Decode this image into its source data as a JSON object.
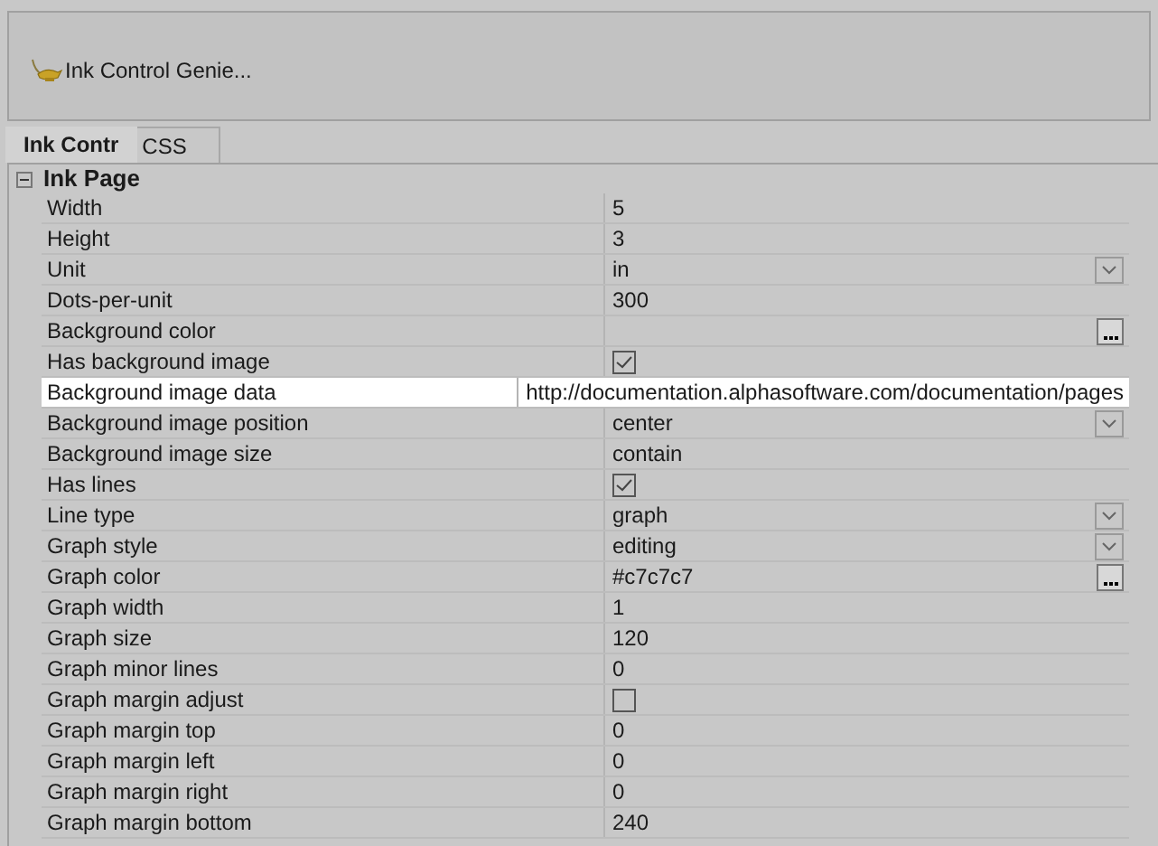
{
  "toolbar": {
    "button": "Ink Control Genie..."
  },
  "tabs": [
    {
      "label": "Ink Contr",
      "selected": true
    },
    {
      "label": "CSS",
      "selected": false
    }
  ],
  "grid": {
    "group": {
      "label": "Ink Page",
      "expanded": true
    },
    "rows": [
      {
        "label": "Width",
        "value": "5",
        "kind": "text",
        "selected": false
      },
      {
        "label": "Height",
        "value": "3",
        "kind": "text",
        "selected": false
      },
      {
        "label": "Unit",
        "value": "in",
        "kind": "dropdown",
        "selected": false
      },
      {
        "label": "Dots-per-unit",
        "value": "300",
        "kind": "text",
        "selected": false
      },
      {
        "label": "Background color",
        "kind": "ellipsis",
        "selected": false
      },
      {
        "label": "Has background image",
        "kind": "checkbox",
        "checked": true,
        "selected": false
      },
      {
        "label": "Background image data",
        "value": "http://documentation.alphasoftware.com/documentation/pages",
        "kind": "text",
        "selected": true
      },
      {
        "label": "Background image position",
        "value": "center",
        "kind": "dropdown",
        "selected": false
      },
      {
        "label": "Background image size",
        "value": "contain",
        "kind": "text",
        "selected": false
      },
      {
        "label": "Has lines",
        "kind": "checkbox",
        "checked": true,
        "selected": false
      },
      {
        "label": "Line type",
        "value": "graph",
        "kind": "dropdown",
        "selected": false
      },
      {
        "label": "Graph style",
        "value": "editing",
        "kind": "dropdown",
        "selected": false
      },
      {
        "label": "Graph color",
        "value": "#c7c7c7",
        "kind": "ellipsis",
        "selected": false
      },
      {
        "label": "Graph width",
        "value": "1",
        "kind": "text",
        "selected": false
      },
      {
        "label": "Graph size",
        "value": "120",
        "kind": "text",
        "selected": false
      },
      {
        "label": "Graph minor lines",
        "value": "0",
        "kind": "text",
        "selected": false
      },
      {
        "label": "Graph margin adjust",
        "kind": "checkbox",
        "checked": false,
        "selected": false
      },
      {
        "label": "Graph margin top",
        "value": "0",
        "kind": "text",
        "selected": false
      },
      {
        "label": "Graph margin left",
        "value": "0",
        "kind": "text",
        "selected": false
      },
      {
        "label": "Graph margin right",
        "value": "0",
        "kind": "text",
        "selected": false
      },
      {
        "label": "Graph margin bottom",
        "value": "240",
        "kind": "text",
        "selected": false
      }
    ]
  }
}
